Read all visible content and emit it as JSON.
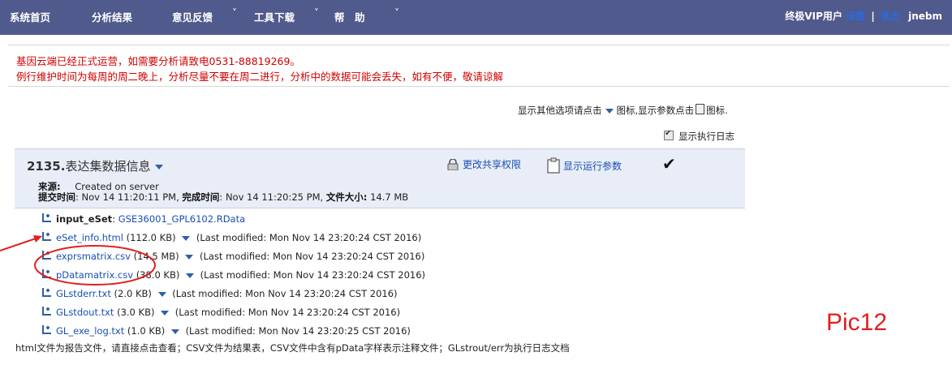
{
  "nav": {
    "items": [
      {
        "label": "系统首页"
      },
      {
        "label": "分析结果"
      },
      {
        "label": "意见反馈"
      },
      {
        "label": "工具下载"
      },
      {
        "label": "帮　助"
      }
    ],
    "user_level": "终极VIP用户",
    "settings_link": "设置",
    "separator": "|",
    "logout_link": "退出",
    "username": "jnebm"
  },
  "notice": {
    "line1": "基因云端已经正式运营，如需要分析请致电0531-88819269。",
    "line2": "例行维护时间为每周的周二晚上，分析尽量不要在周二进行，分析中的数据可能会丢失，如有不便，敬请谅解"
  },
  "hints": {
    "prefix": "显示其他选项请点击",
    "mid": "图标,显示参数点击",
    "suffix": "图标."
  },
  "log_toggle": {
    "label": "显示执行日志",
    "checked": true
  },
  "dataset": {
    "id": "2135.",
    "title": "表达集数据信息",
    "share_action": "更改共享权限",
    "params_action": "显示运行参数",
    "check_mark": "✔",
    "source_label": "来源:",
    "source_value": "Created on server",
    "submit_label": "提交时间",
    "submit_value": "Nov 14 11:20:11 PM,",
    "done_label": "完成时间",
    "done_value": "Nov 14 11:20:25 PM,",
    "size_label": "文件大小:",
    "size_value": "14.7 MB"
  },
  "input_row": {
    "label": "input_eSet",
    "file": "GSE36001_GPL6102.RData"
  },
  "files": [
    {
      "name": "eSet_info.html",
      "size": "(112.0 KB)",
      "modified": "(Last modified: Mon Nov 14 23:20:24 CST 2016)"
    },
    {
      "name": "exprsmatrix.csv",
      "size": "(14.5 MB)",
      "modified": "(Last modified: Mon Nov 14 23:20:24 CST 2016)"
    },
    {
      "name": "pDatamatrix.csv",
      "size": "(38.0 KB)",
      "modified": "(Last modified: Mon Nov 14 23:20:24 CST 2016)"
    },
    {
      "name": "GLstderr.txt",
      "size": "(2.0 KB)",
      "modified": "(Last modified: Mon Nov 14 23:20:24 CST 2016)"
    },
    {
      "name": "GLstdout.txt",
      "size": "(3.0 KB)",
      "modified": "(Last modified: Mon Nov 14 23:20:24 CST 2016)"
    },
    {
      "name": "GL_exe_log.txt",
      "size": "(1.0 KB)",
      "modified": "(Last modified: Mon Nov 14 23:20:25 CST 2016)"
    }
  ],
  "footer_note": "html文件为报告文件，请直接点击查看；CSV文件为结果表，CSV文件中含有pData字样表示注释文件；GLstrout/err为执行日志文档",
  "pic_label": "Pic12",
  "colors": {
    "nav_bg": "#505a8c",
    "notice_text": "#d00000",
    "link": "#1a4fb4",
    "panel_bg": "#e8edf7",
    "annotation": "#e02020"
  }
}
